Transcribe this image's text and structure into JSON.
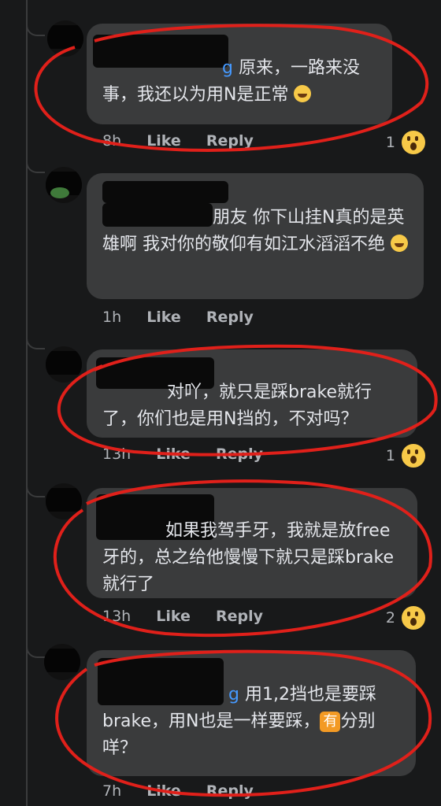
{
  "comments": [
    {
      "name_suffix": "g",
      "text": "原来，一路来没事，我还以为用N是正常",
      "emoji": "grinning-squinting-face",
      "time": "8h",
      "like_label": "Like",
      "reply_label": "Reply",
      "reaction_count": "1"
    },
    {
      "text": "朋友 你下山挂N真的是英雄啊 我对你的敬仰有如江水滔滔不绝",
      "emoji": "grinning-squinting-face",
      "time": "1h",
      "like_label": "Like",
      "reply_label": "Reply"
    },
    {
      "text": "对吖，就只是踩brake就行了，你们也是用N挡的，不对吗？",
      "time": "13h",
      "like_label": "Like",
      "reply_label": "Reply",
      "reaction_count": "1"
    },
    {
      "text": "如果我驾手牙，我就是放free牙的，总之给他慢慢下就只是踩brake就行了",
      "time": "13h",
      "like_label": "Like",
      "reply_label": "Reply",
      "reaction_count": "2"
    },
    {
      "name_suffix": "g",
      "text_before": "用1,2挡也是要踩brake，用N也是一样要踩，",
      "badge": "有",
      "text_after": "分别咩？",
      "time": "7h",
      "like_label": "Like",
      "reply_label": "Reply"
    }
  ],
  "reaction_icon": "wow-face-icon",
  "annotation_color": "#e0201a"
}
